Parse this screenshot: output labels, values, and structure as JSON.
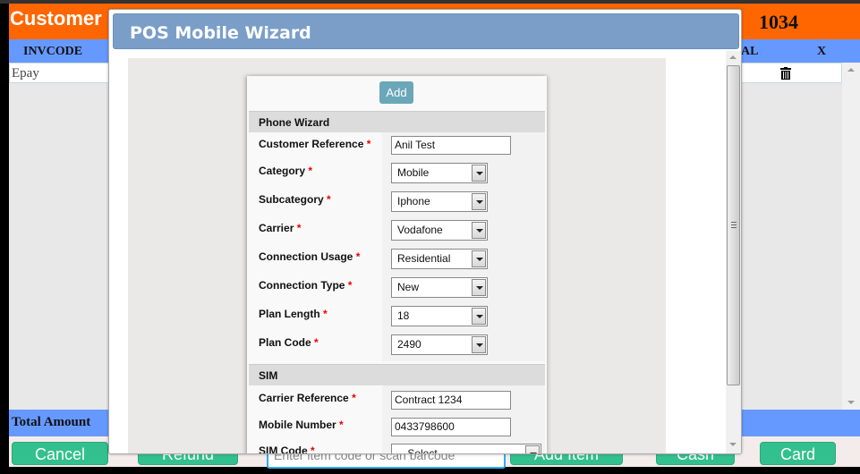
{
  "page": {
    "title": "Customer",
    "number": "1034",
    "table": {
      "columns": [
        "INVCODE",
        "AL",
        "X"
      ],
      "rows": [
        {
          "invcode": "Epay",
          "delete_icon": "trash-icon"
        }
      ]
    },
    "total_label": "Total Amount",
    "buttons": {
      "cancel": "Cancel",
      "refund": "Refund",
      "add_item": "Add Item",
      "cash": "Cash",
      "card": "Card"
    },
    "barcode_placeholder": "Enter item code or scan barcode"
  },
  "modal": {
    "title": "POS Mobile Wizard",
    "add_label": "Add",
    "sections": [
      {
        "title": "Phone Wizard",
        "fields": [
          {
            "label": "Customer Reference",
            "required": "*",
            "type": "text",
            "value": "Anil Test"
          },
          {
            "label": "Category",
            "required": "*",
            "type": "select",
            "value": "Mobile"
          },
          {
            "label": "Subcategory",
            "required": "*",
            "type": "select",
            "value": "Iphone"
          },
          {
            "label": "Carrier",
            "required": "*",
            "type": "select",
            "value": "Vodafone"
          },
          {
            "label": "Connection Usage",
            "required": "*",
            "type": "select",
            "value": "Residential"
          },
          {
            "label": "Connection Type",
            "required": "*",
            "type": "select",
            "value": "New"
          },
          {
            "label": "Plan Length",
            "required": "*",
            "type": "select",
            "value": "18"
          },
          {
            "label": "Plan Code",
            "required": "*",
            "type": "select",
            "value": "2490"
          }
        ]
      },
      {
        "title": "SIM",
        "fields": [
          {
            "label": "Carrier Reference",
            "required": "*",
            "type": "text",
            "value": "Contract 1234"
          },
          {
            "label": "Mobile Number",
            "required": "*",
            "type": "text",
            "value": "0433798600"
          },
          {
            "label": "SIM Code",
            "required": "*",
            "type": "select",
            "value": "-- Select --"
          }
        ]
      }
    ]
  },
  "colors": {
    "header_orange": "#ff6600",
    "table_head_blue": "#6699ff",
    "button_green": "#33c08f",
    "modal_header": "#7a9ec8",
    "add_button": "#6aa7b8",
    "required_red": "#ee0000"
  }
}
